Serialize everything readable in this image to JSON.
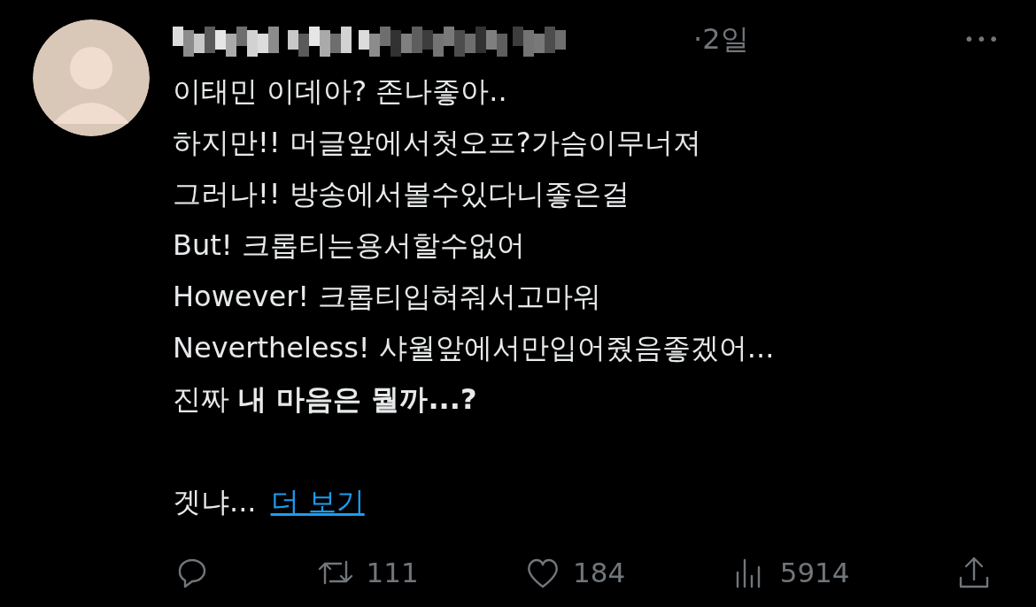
{
  "tweet": {
    "time": "·2일",
    "more": "•••",
    "lines": [
      "이태민 이데아? 존나좋아..",
      "하지만!! 머글앞에서첫오프?가슴이무너져",
      "그러나!! 방송에서볼수있다니좋은걸",
      "But! 크롭티는용서할수없어",
      "However! 크롭티입혀줘서고마워",
      "Nevertheless! 샤월앞에서만입어줬음좋겠어...",
      "진짜 **내 마음은 뭘까...?**"
    ],
    "tail": "겟냐...",
    "show_more": "더 보기",
    "actions": [
      {
        "kind": "reply"
      },
      {
        "kind": "retweet",
        "count": "111"
      },
      {
        "kind": "like",
        "count": "184"
      },
      {
        "kind": "views",
        "count": "5914"
      },
      {
        "kind": "share"
      }
    ]
  }
}
